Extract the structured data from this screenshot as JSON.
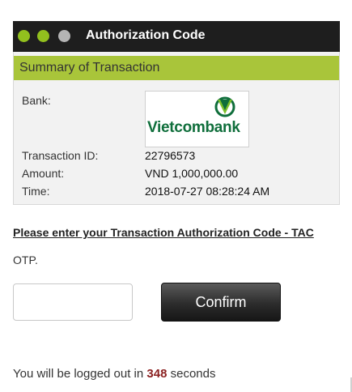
{
  "window": {
    "title": "Authorization Code",
    "dots": [
      "green",
      "green",
      "gray"
    ]
  },
  "summary": {
    "heading": "Summary of Transaction",
    "bank_label": "Bank:",
    "bank_logo_text": "Vietcombank",
    "rows": [
      {
        "label": "Transaction ID:",
        "value": "22796573"
      },
      {
        "label": "Amount:",
        "value": "VND 1,000,000.00"
      },
      {
        "label": "Time:",
        "value": "2018-07-27 08:28:24 AM"
      }
    ]
  },
  "form": {
    "tac_prompt": "Please enter your Transaction Authorization Code - TAC",
    "otp_label": "OTP.",
    "otp_value": "",
    "confirm_label": "Confirm"
  },
  "logout": {
    "prefix": "You will be logged out in",
    "seconds": "348",
    "suffix": "seconds"
  },
  "colors": {
    "accent_green": "#a9c53a",
    "titlebar": "#1e1e1e",
    "countdown": "#8a1f1f",
    "brand_green": "#0f6e3b"
  },
  "icons": {
    "bank_logo_mark": "vietcombank-logo-icon"
  }
}
